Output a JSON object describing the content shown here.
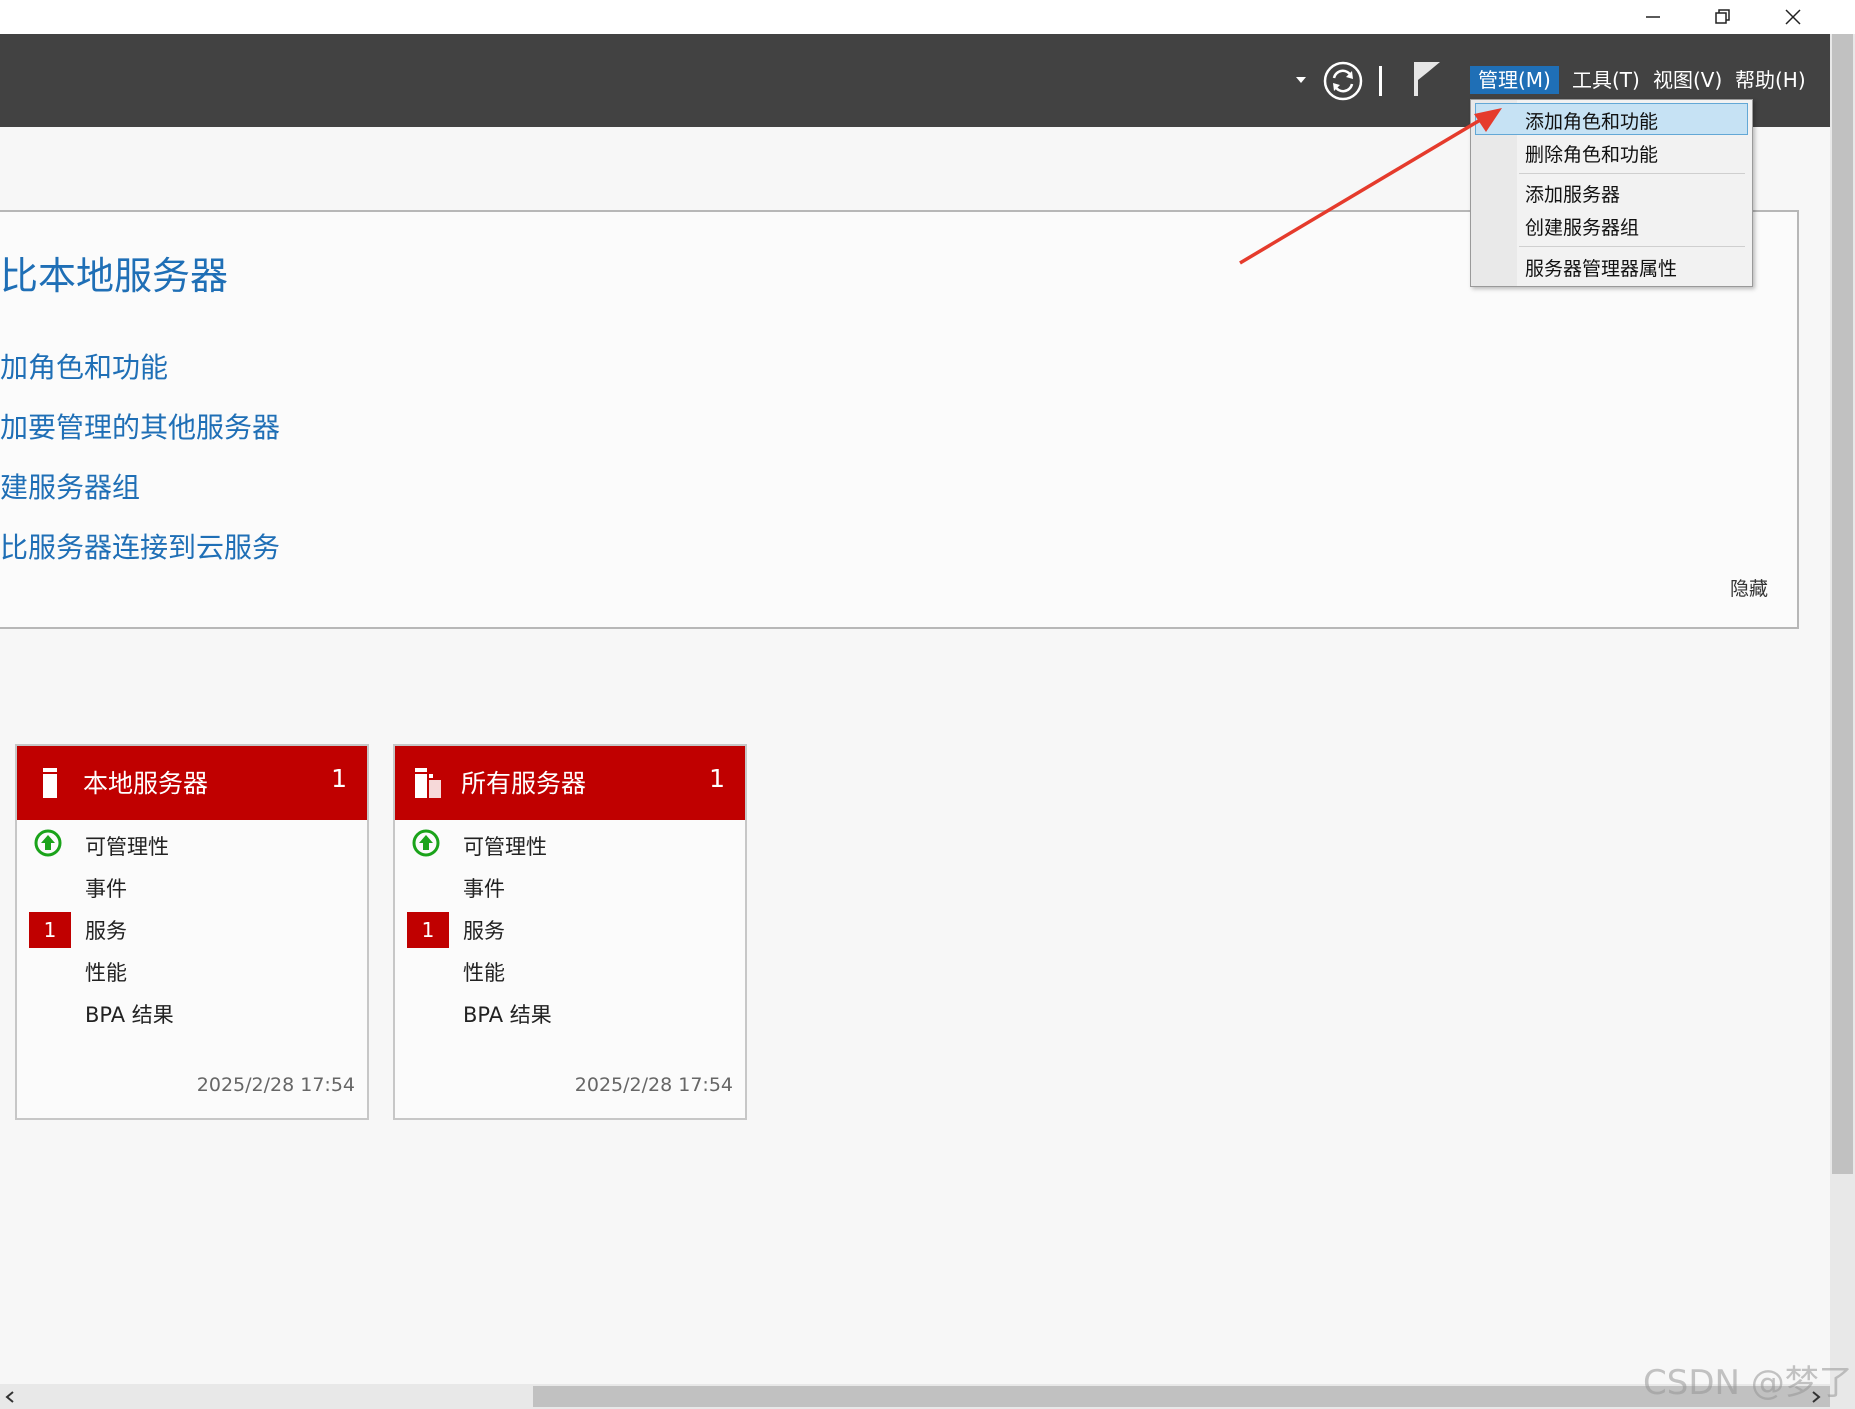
{
  "toolbar": {
    "menus": [
      "管理(M)",
      "工具(T)",
      "视图(V)",
      "帮助(H)"
    ]
  },
  "dropdown": {
    "items": [
      "添加角色和功能",
      "删除角色和功能",
      "添加服务器",
      "创建服务器组",
      "服务器管理器属性"
    ]
  },
  "welcome": {
    "heading": "比本地服务器",
    "links": [
      "加角色和功能",
      "加要管理的其他服务器",
      "建服务器组",
      "比服务器连接到云服务"
    ],
    "hide": "隐藏"
  },
  "tiles": [
    {
      "title": "本地服务器",
      "count": "1",
      "rows": [
        "可管理性",
        "事件",
        "服务",
        "性能",
        "BPA 结果"
      ],
      "badge": "1",
      "timestamp": "2025/2/28 17:54"
    },
    {
      "title": "所有服务器",
      "count": "1",
      "rows": [
        "可管理性",
        "事件",
        "服务",
        "性能",
        "BPA 结果"
      ],
      "badge": "1",
      "timestamp": "2025/2/28 17:54"
    }
  ],
  "watermark": "CSDN @梦了",
  "colors": {
    "accent": "#1f6fb6",
    "tile_red": "#c00000",
    "toolbar": "#424242"
  },
  "icons": [
    "minimize-icon",
    "restore-icon",
    "close-icon",
    "dropdown-caret-icon",
    "refresh-icon",
    "flag-icon",
    "server-icon",
    "servers-icon",
    "status-ok-icon",
    "scroll-left-icon",
    "scroll-right-icon"
  ]
}
